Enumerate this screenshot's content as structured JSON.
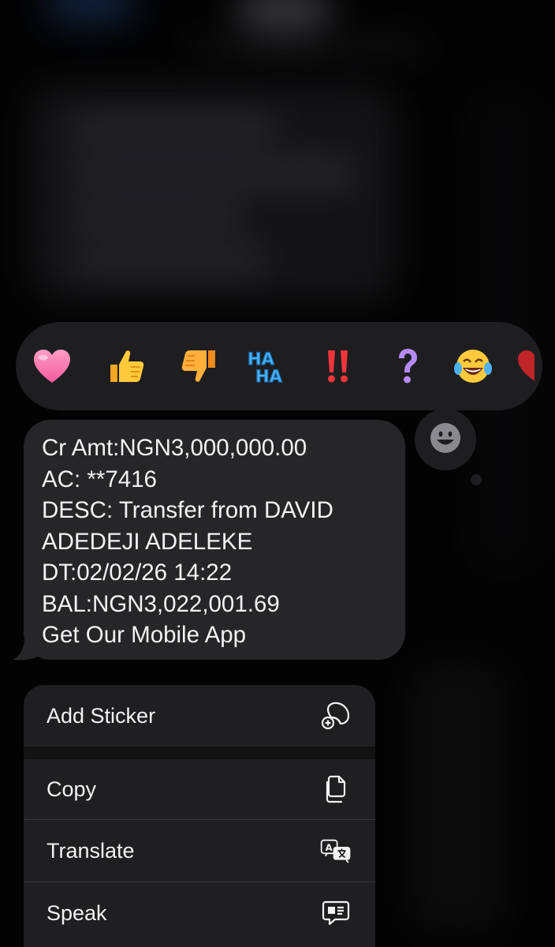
{
  "message": {
    "lines": [
      "Cr Amt:NGN3,000,000.00",
      "AC: **7416",
      "DESC: Transfer from DAVID",
      "ADEDEJI ADELEKE",
      "DT:02/02/26 14:22",
      "BAL:NGN3,022,001.69",
      "Get Our Mobile App"
    ]
  },
  "reactions": {
    "items": [
      "heart",
      "thumbs-up",
      "thumbs-down",
      "haha",
      "exclamation",
      "question",
      "laughing",
      "more"
    ]
  },
  "menu": {
    "items": [
      {
        "label": "Add Sticker",
        "icon": "sticker-add-icon"
      },
      {
        "label": "Copy",
        "icon": "copy-icon"
      },
      {
        "label": "Translate",
        "icon": "translate-icon"
      },
      {
        "label": "Speak",
        "icon": "speak-icon"
      }
    ]
  },
  "colors": {
    "bubble": "#262629",
    "menu": "#1f1f21",
    "text": "#f2f2f4"
  }
}
